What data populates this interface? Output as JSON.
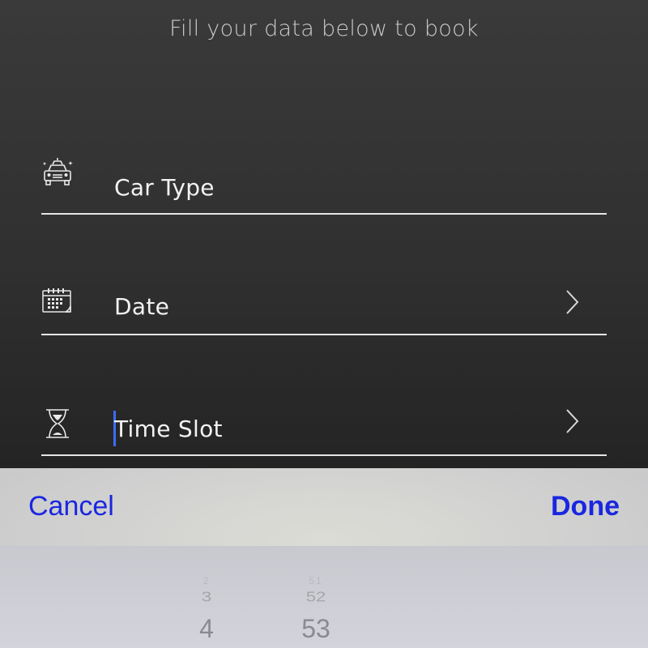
{
  "header": {
    "subtitle": "Fill your data below to book"
  },
  "form": {
    "fields": [
      {
        "id": "car_type",
        "label": "Car Type",
        "icon": "car-icon",
        "has_chevron": false
      },
      {
        "id": "date",
        "label": "Date",
        "icon": "calendar-icon",
        "has_chevron": true
      },
      {
        "id": "time_slot",
        "label": "Time Slot",
        "icon": "hourglass-icon",
        "has_chevron": true,
        "focused": true
      }
    ]
  },
  "picker": {
    "cancel_label": "Cancel",
    "done_label": "Done",
    "hours": {
      "above2": "2",
      "above1": "3",
      "selected": "4"
    },
    "minutes": {
      "above2": "51",
      "above1": "52",
      "selected": "53"
    }
  },
  "colors": {
    "accent": "#1a27e0",
    "cursor": "#3d6cff",
    "field_text": "#f2f2f2",
    "subtitle": "#c9c9c9"
  }
}
